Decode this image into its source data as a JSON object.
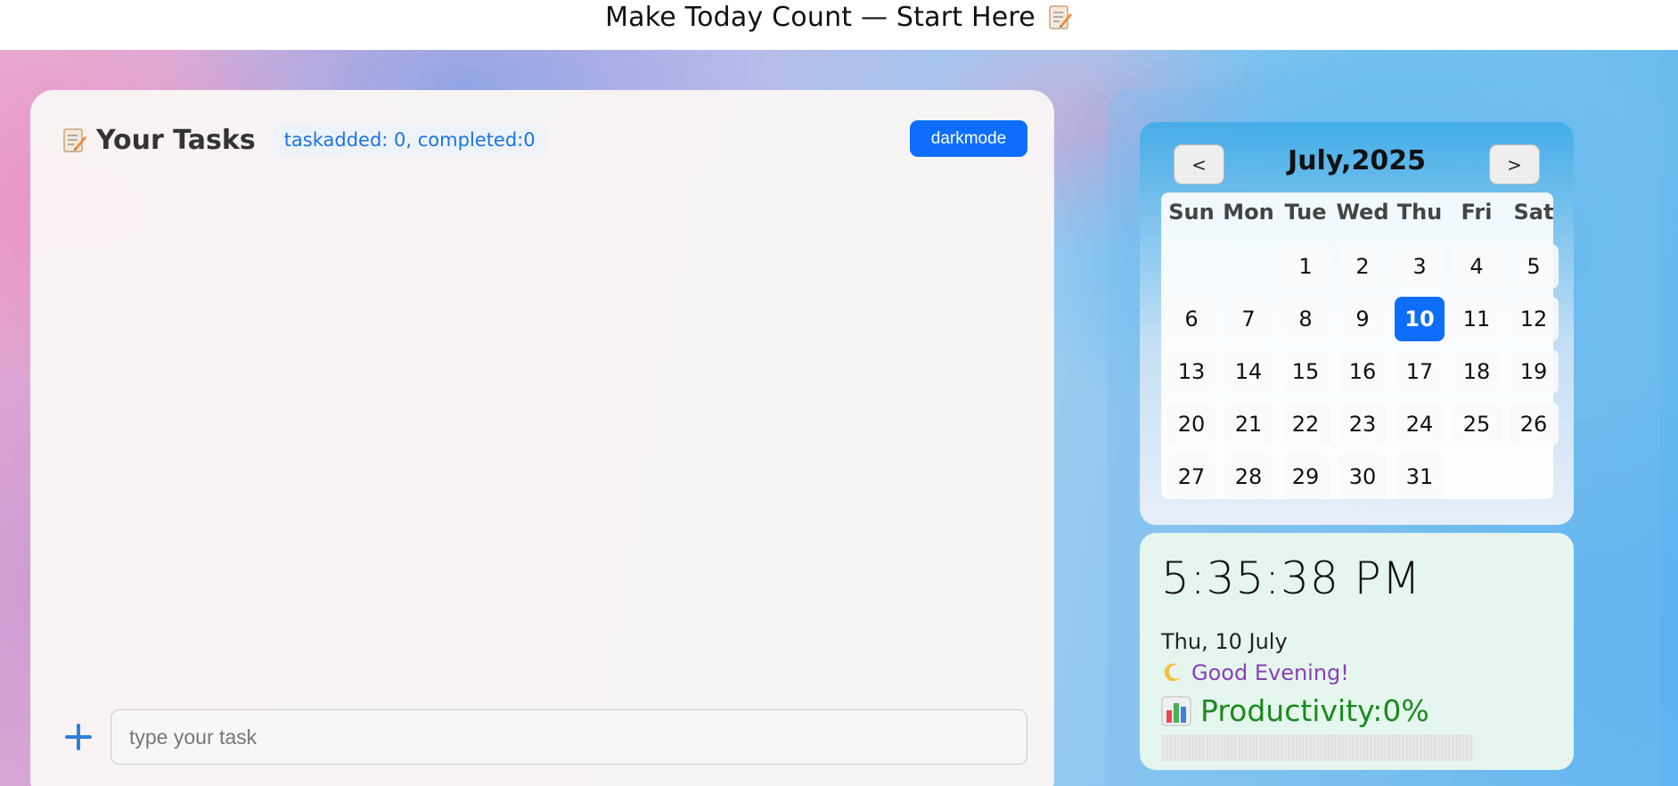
{
  "header": {
    "title": "Make Today Count — Start Here",
    "icon": "memo-icon"
  },
  "tasks": {
    "title": "Your Tasks",
    "icon": "memo-icon",
    "counter": "taskadded: 0, completed:0",
    "darkmode_label": "darkmode",
    "input_placeholder": "type your task",
    "add_icon": "plus-icon"
  },
  "calendar": {
    "prev_label": "<",
    "next_label": ">",
    "month_label": "July,2025",
    "weekdays": [
      "Sun",
      "Mon",
      "Tue",
      "Wed",
      "Thu",
      "Fri",
      "Sat"
    ],
    "days": [
      "1",
      "2",
      "3",
      "4",
      "5",
      "6",
      "7",
      "8",
      "9",
      "10",
      "11",
      "12",
      "13",
      "14",
      "15",
      "16",
      "17",
      "18",
      "19",
      "20",
      "21",
      "22",
      "23",
      "24",
      "25",
      "26",
      "27",
      "28",
      "29",
      "30",
      "31"
    ],
    "today": "10",
    "accent": "#0d6efd"
  },
  "clock": {
    "time": "5:35:38 PM",
    "date": "Thu, 10 July",
    "greeting": "Good Evening!",
    "greeting_icon": "moon-icon",
    "productivity_label": "Productivity:0%",
    "productivity_icon": "bar-chart-icon",
    "productivity_percent": 0
  }
}
